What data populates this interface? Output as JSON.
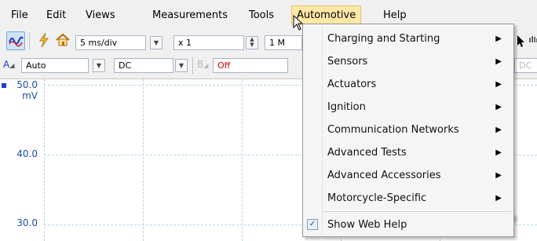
{
  "menubar": {
    "items": [
      {
        "id": "file",
        "label": "File"
      },
      {
        "id": "edit",
        "label": "Edit"
      },
      {
        "id": "views",
        "label": "Views"
      },
      {
        "id": "measurements",
        "label": "Measurements"
      },
      {
        "id": "tools",
        "label": "Tools"
      },
      {
        "id": "automotive",
        "label": "Automotive"
      },
      {
        "id": "help",
        "label": "Help"
      }
    ]
  },
  "toolbar1": {
    "timebase": "5 ms/div",
    "zoom": "x 1",
    "samples": "1 M"
  },
  "toolbar2": {
    "channel_a_label": "A",
    "channel_a_range": "Auto",
    "channel_a_coupling": "DC",
    "channel_b_label": "B",
    "channel_b_range": "Off",
    "channel_b_coupling": "DC"
  },
  "plot": {
    "y_labels": [
      "50.0",
      "mV",
      "40.0",
      "30.0"
    ],
    "marker_color": "#1a3bd0"
  },
  "automotive_menu": {
    "items": [
      {
        "label": "Charging and Starting",
        "submenu": true
      },
      {
        "label": "Sensors",
        "submenu": true
      },
      {
        "label": "Actuators",
        "submenu": true
      },
      {
        "label": "Ignition",
        "submenu": true
      },
      {
        "label": "Communication Networks",
        "submenu": true
      },
      {
        "label": "Advanced Tests",
        "submenu": true
      },
      {
        "label": "Advanced Accessories",
        "submenu": true
      },
      {
        "label": "Motorcycle-Specific",
        "submenu": true
      }
    ],
    "show_web_help": {
      "label": "Show Web Help",
      "checked": true
    }
  },
  "colors": {
    "menu_highlight": "#ffe8a6",
    "grid": "#b9d6e4",
    "axis_text": "#1d4fa0"
  }
}
